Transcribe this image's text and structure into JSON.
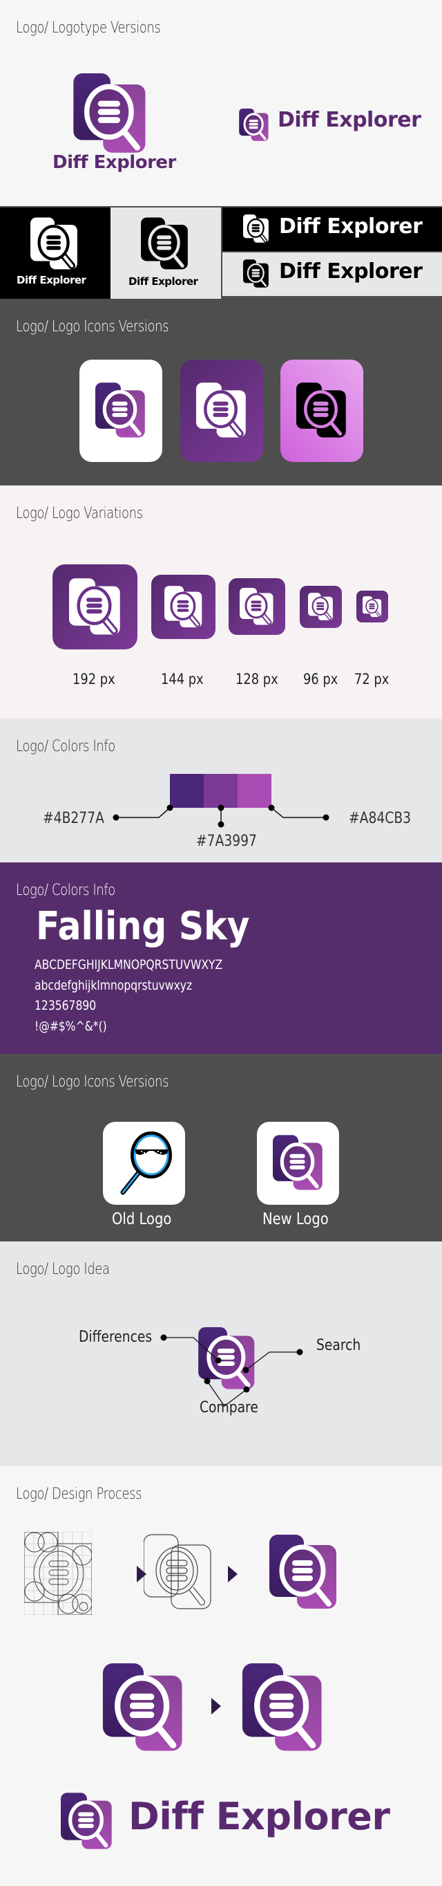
{
  "brand": {
    "name": "Diff Explorer",
    "colors": {
      "dark": "#4B277A",
      "mid": "#7A3997",
      "light": "#A84CB3"
    }
  },
  "sections": {
    "logotype": {
      "title": "Logo/ Logotype Versions",
      "wordmark": "Diff Explorer"
    },
    "mono": {
      "items": [
        {
          "wordmark": "Diff Explorer",
          "variant": "white-on-black"
        },
        {
          "wordmark": "Diff Explorer",
          "variant": "black-on-light"
        },
        {
          "wordmark": "Diff Explorer",
          "variant": "white-on-black-horizontal"
        },
        {
          "wordmark": "Diff Explorer",
          "variant": "black-on-light-horizontal"
        }
      ]
    },
    "icon_versions": {
      "title": "Logo/ Logo Icons Versions",
      "tiles": [
        {
          "background": "white",
          "name": "icon-white-bg"
        },
        {
          "background": "purple",
          "name": "icon-purple-bg"
        },
        {
          "background": "pink",
          "name": "icon-pink-bg"
        }
      ]
    },
    "variations": {
      "title": "Logo/ Logo Variations",
      "sizes": [
        {
          "label": "192 px"
        },
        {
          "label": "144 px"
        },
        {
          "label": "128 px"
        },
        {
          "label": "96 px"
        },
        {
          "label": "72 px"
        }
      ]
    },
    "colors_info": {
      "title": "Logo/ Colors Info",
      "swatches": [
        {
          "hex": "#4B277A",
          "label": "#4B277A"
        },
        {
          "hex": "#7A3997",
          "label": "#7A3997"
        },
        {
          "hex": "#A84CB3",
          "label": "#A84CB3"
        }
      ]
    },
    "typography": {
      "title": "Logo/ Colors Info",
      "font_name": "Falling Sky",
      "uppercase": "ABCDEFGHIJKLMNOPQRSTUVWXYZ",
      "lowercase": "abcdefghijklmnopqrstuvwxyz",
      "numbers": "123567890",
      "symbols": "!@#$%^&*()"
    },
    "old_new": {
      "title": "Logo/ Logo Icons Versions",
      "old_label": "Old Logo",
      "new_label": "New Logo"
    },
    "idea": {
      "title": "Logo/ Logo Idea",
      "labels": {
        "differences": "Differences",
        "search": "Search",
        "compare": "Compare"
      }
    },
    "process": {
      "title": "Logo/ Design Process",
      "final_wordmark": "Diff Explorer"
    }
  }
}
